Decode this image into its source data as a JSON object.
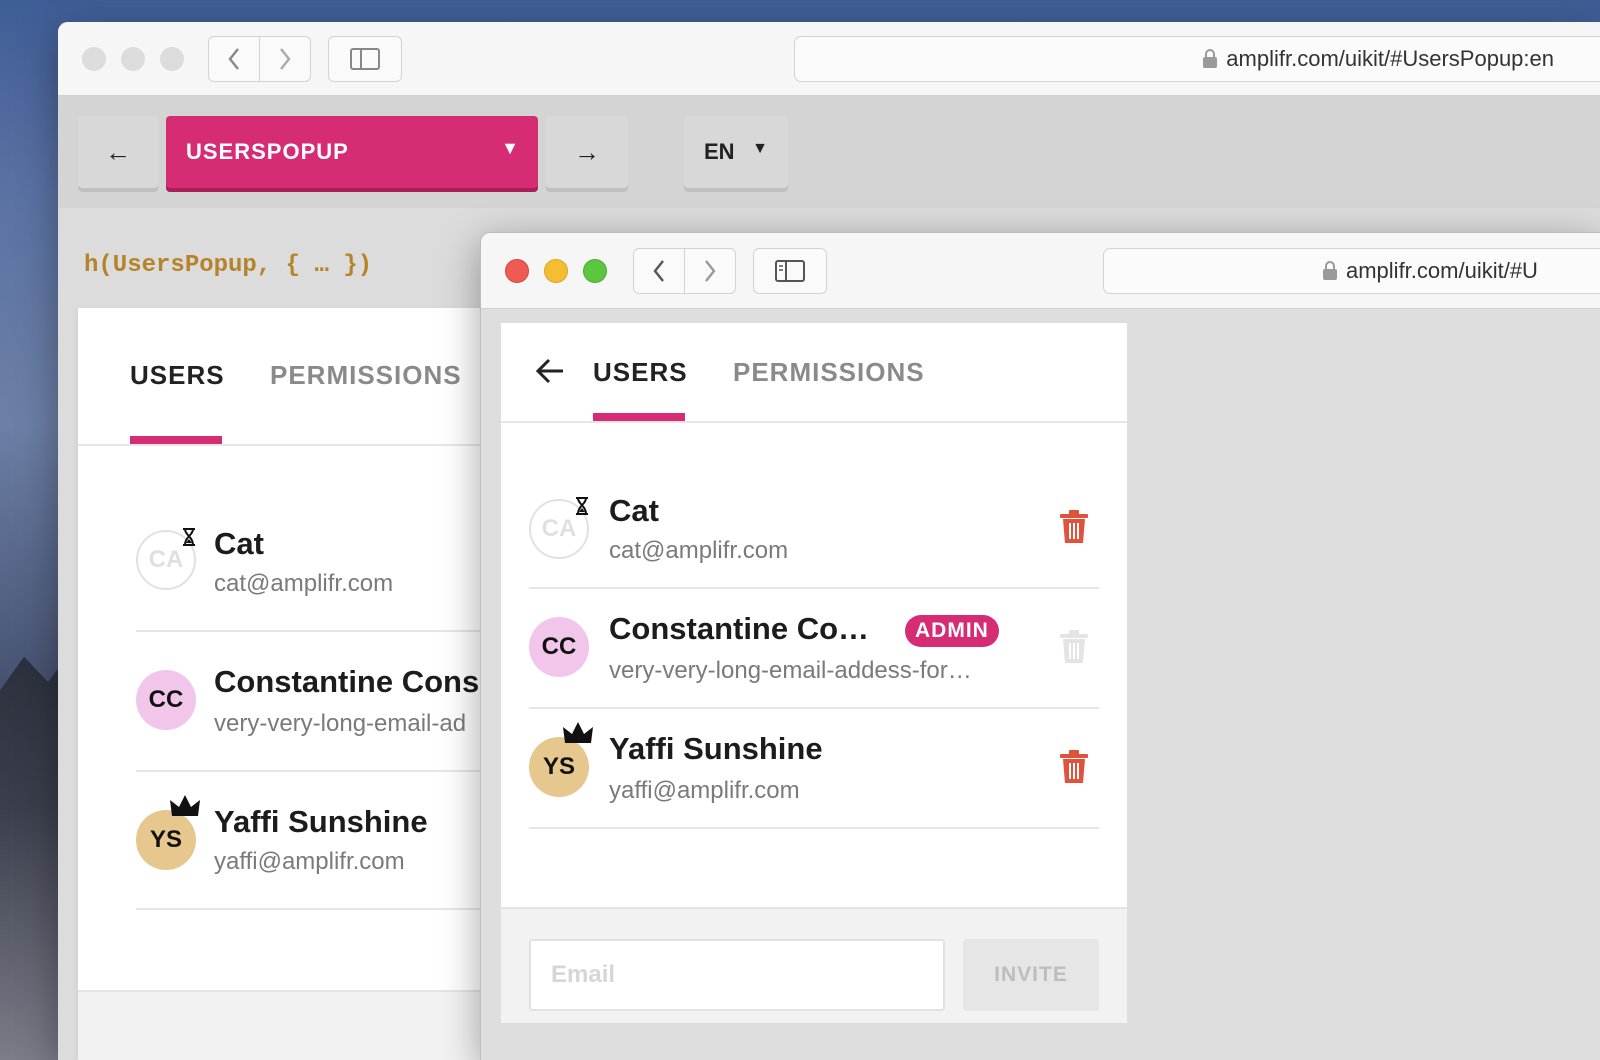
{
  "back_window": {
    "url": "amplifr.com/uikit/#UsersPopup:en",
    "toolbar": {
      "prev_label": "←",
      "component_select": "USERSPOPUP",
      "next_label": "→",
      "language_select": "EN"
    },
    "code_snippet": "h(UsersPopup, { … })",
    "tabs": [
      "USERS",
      "PERMISSIONS"
    ],
    "users": [
      {
        "initials": "CA",
        "name": "Cat",
        "email": "cat@amplifr.com"
      },
      {
        "initials": "CC",
        "name": "Constantine Cons",
        "email": "very-very-long-email-ad"
      },
      {
        "initials": "YS",
        "name": "Yaffi Sunshine",
        "email": "yaffi@amplifr.com"
      }
    ]
  },
  "front_window": {
    "url": "amplifr.com/uikit/#U",
    "tabs": [
      "USERS",
      "PERMISSIONS"
    ],
    "users": [
      {
        "initials": "CA",
        "name": "Cat",
        "email": "cat@amplifr.com",
        "status": "pending"
      },
      {
        "initials": "CC",
        "name": "Constantine Co…",
        "email": "very-very-long-email-addess-for…",
        "badge": "ADMIN"
      },
      {
        "initials": "YS",
        "name": "Yaffi Sunshine",
        "email": "yaffi@amplifr.com",
        "role": "owner"
      }
    ],
    "invite": {
      "email_placeholder": "Email",
      "button_label": "INVITE"
    }
  },
  "colors": {
    "accent": "#d62c74",
    "trash": "#e0533a",
    "close": "#ee5b52",
    "minimize": "#f5bd32",
    "zoom": "#5bc63e"
  },
  "icons": [
    "lock-icon",
    "chevron-left-icon",
    "chevron-right-icon",
    "sidebar-icon",
    "arrow-left-icon",
    "hourglass-icon",
    "crown-icon",
    "trash-icon",
    "dropdown-arrow-icon"
  ]
}
